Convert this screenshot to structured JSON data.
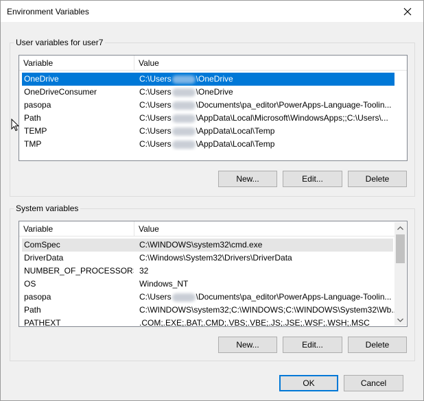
{
  "window": {
    "title": "Environment Variables"
  },
  "user": {
    "group_label": "User variables for user7",
    "columns": [
      "Variable",
      "Value"
    ],
    "rows": [
      {
        "variable": "OneDrive",
        "value_prefix": "C:\\Users",
        "value_suffix": "\\OneDrive"
      },
      {
        "variable": "OneDriveConsumer",
        "value_prefix": "C:\\Users",
        "value_suffix": "\\OneDrive"
      },
      {
        "variable": "pasopa",
        "value_prefix": "C:\\Users",
        "value_suffix": "\\Documents\\pa_editor\\PowerApps-Language-Toolin..."
      },
      {
        "variable": "Path",
        "value_prefix": "C:\\Users",
        "value_suffix": "\\AppData\\Local\\Microsoft\\WindowsApps;;C:\\Users\\..."
      },
      {
        "variable": "TEMP",
        "value_prefix": "C:\\Users",
        "value_suffix": "\\AppData\\Local\\Temp"
      },
      {
        "variable": "TMP",
        "value_prefix": "C:\\Users",
        "value_suffix": "\\AppData\\Local\\Temp"
      }
    ],
    "buttons": {
      "new": "New...",
      "edit": "Edit...",
      "delete": "Delete"
    }
  },
  "system": {
    "group_label": "System variables",
    "columns": [
      "Variable",
      "Value"
    ],
    "rows": [
      {
        "variable": "ComSpec",
        "value": "C:\\WINDOWS\\system32\\cmd.exe"
      },
      {
        "variable": "DriverData",
        "value": "C:\\Windows\\System32\\Drivers\\DriverData"
      },
      {
        "variable": "NUMBER_OF_PROCESSORS",
        "value": "32"
      },
      {
        "variable": "OS",
        "value": "Windows_NT"
      },
      {
        "variable": "pasopa",
        "value_prefix": "C:\\Users",
        "value_suffix": "\\Documents\\pa_editor\\PowerApps-Language-Toolin..."
      },
      {
        "variable": "Path",
        "value": "C:\\WINDOWS\\system32;C:\\WINDOWS;C:\\WINDOWS\\System32\\Wb..."
      },
      {
        "variable": "PATHEXT",
        "value": ".COM;.EXE;.BAT;.CMD;.VBS;.VBE;.JS;.JSE;.WSF;.WSH;.MSC"
      }
    ],
    "buttons": {
      "new": "New...",
      "edit": "Edit...",
      "delete": "Delete"
    }
  },
  "footer": {
    "ok": "OK",
    "cancel": "Cancel"
  },
  "colors": {
    "selection": "#0078d7",
    "default_button_border": "#0078d7"
  }
}
